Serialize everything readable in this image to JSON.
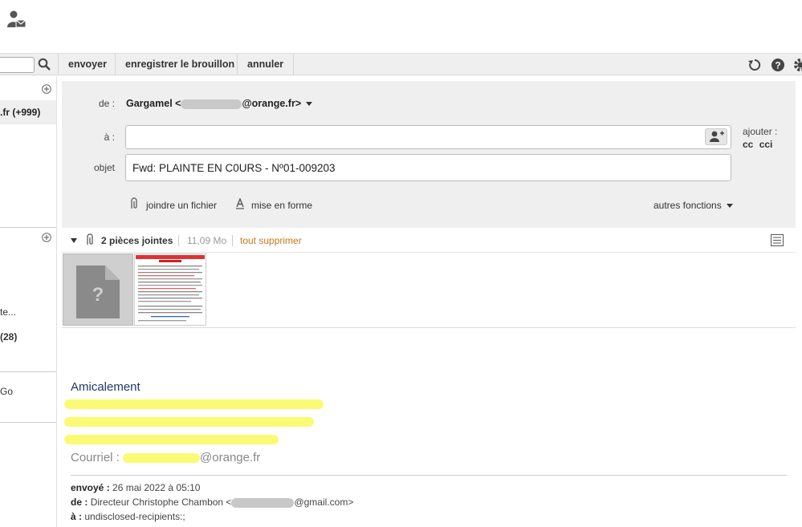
{
  "toolbar": {
    "send": "envoyer",
    "save_draft": "enregistrer le brouillon",
    "cancel": "annuler"
  },
  "sidebar": {
    "selected_item": ".fr (+999)",
    "item_te": "te...",
    "item_count": "(28)",
    "item_go": "Go"
  },
  "compose": {
    "from_label": "de :",
    "from_name": "Gargamel <",
    "from_domain": "@orange.fr>",
    "to_label": "à :",
    "to_value": "",
    "subject_label": "objet",
    "subject_value": "Fwd: PLAINTE EN C0URS - Nº01-009203",
    "add_label": "ajouter :",
    "cc": "cc",
    "bcc": "cci",
    "attach_file": "joindre un fichier",
    "formatting": "mise en forme",
    "other_functions": "autres fonctions"
  },
  "attachments": {
    "count_label": "2 pièces jointes",
    "size": "11,09 Mo",
    "delete_all": "tout supprimer"
  },
  "body": {
    "closing": "Amicalement",
    "email_label": "Courriel : ",
    "email_domain": "@orange.fr",
    "sent_label": "envoyé :",
    "sent_value": "26 mai 2022 à 05:10",
    "from_label": "de :",
    "from_value": "Directeur Christophe Chambon <",
    "from_domain": "@gmail.com>",
    "to_label": "à :",
    "to_value": "undisclosed-recipients:;"
  },
  "colors": {
    "highlight": "#fafa6e",
    "delete_link": "#c8781e",
    "panel_bg": "#efefef",
    "signature_blue": "#1f3a64"
  }
}
